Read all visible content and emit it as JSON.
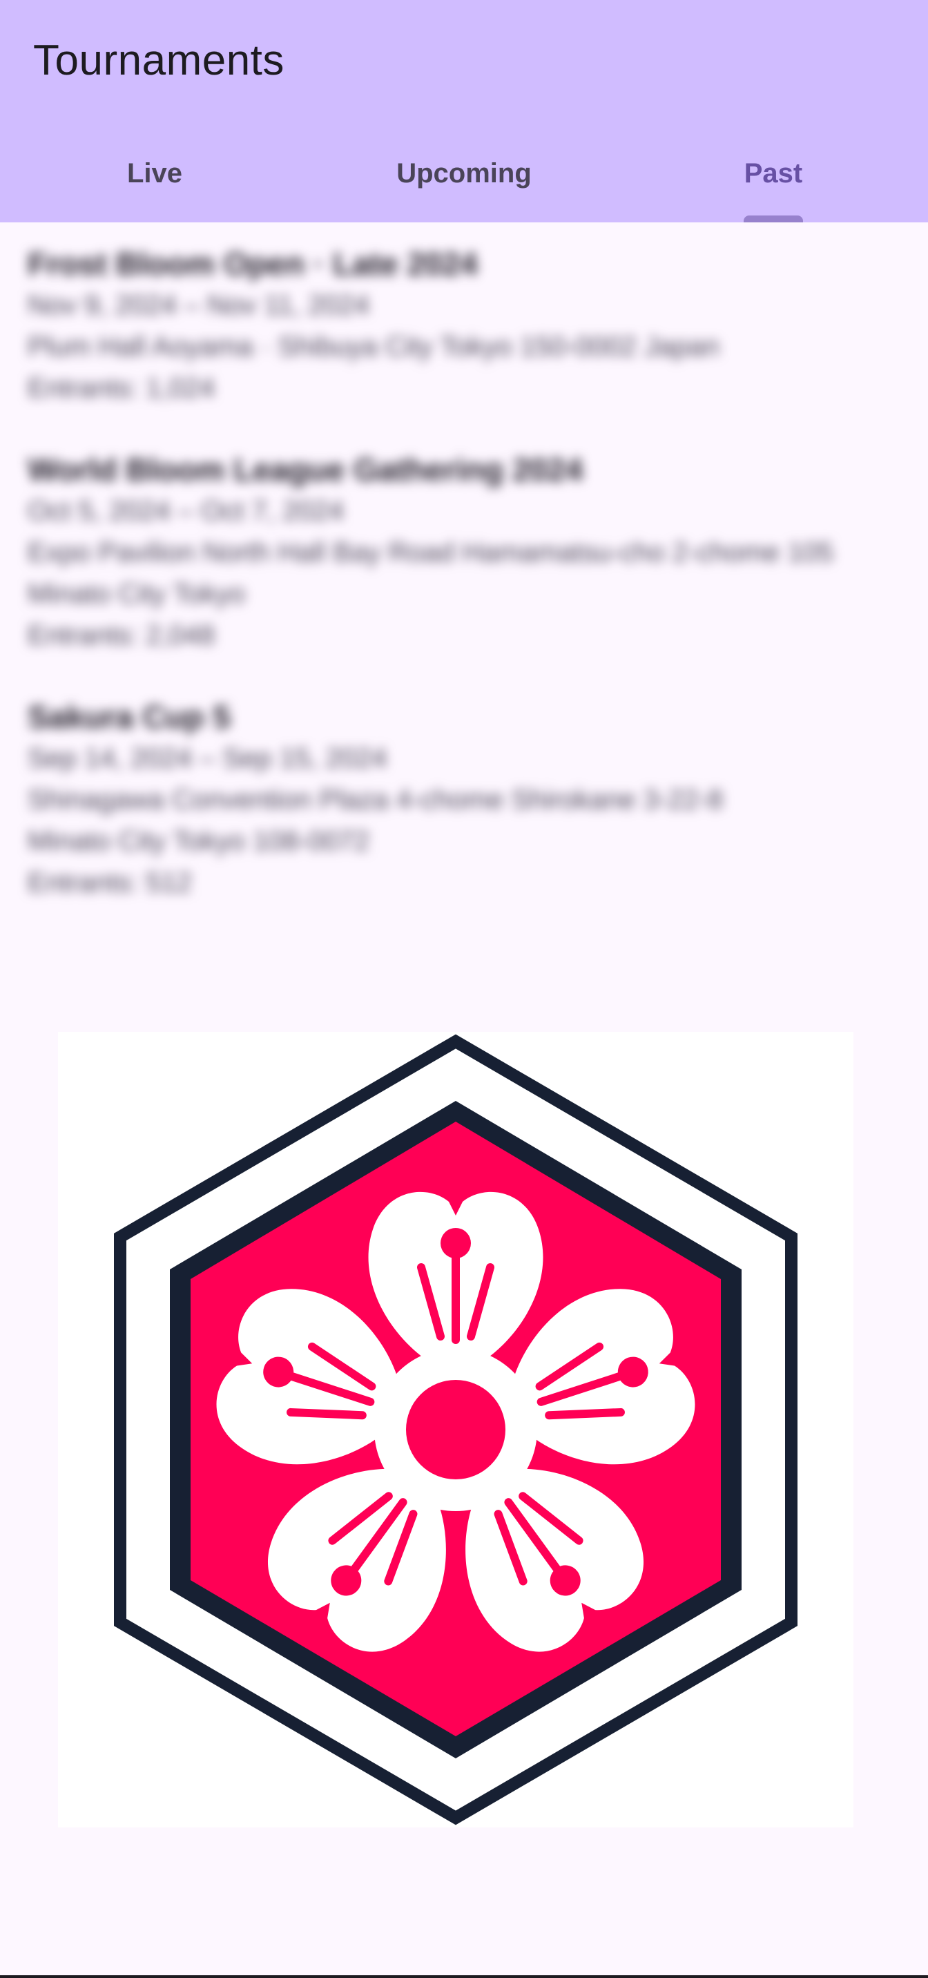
{
  "app_bar": {
    "title": "Tournaments"
  },
  "tabs": [
    {
      "label": "Live",
      "active": false
    },
    {
      "label": "Upcoming",
      "active": false
    },
    {
      "label": "Past",
      "active": true
    }
  ],
  "tournaments": [
    {
      "name": "Frost Bloom Open · Late 2024",
      "dates": "Nov 9, 2024 – Nov 11, 2024",
      "description": "Plum Hall Aoyama · Shibuya City Tokyo 150-0002 Japan",
      "entrants": "Entrants: 1,024"
    },
    {
      "name": "World Bloom League Gathering 2024",
      "dates": "Oct 5, 2024 – Oct 7, 2024",
      "description": "Expo Pavilion North Hall Bay Road Hamamatsu-cho 2-chome 105",
      "description_2": "Minato City Tokyo",
      "entrants": "Entrants: 2,048"
    },
    {
      "name": "Sakura Cup 5",
      "dates": "Sep 14, 2024 – Sep 15, 2024",
      "description": "Shinagawa Convention Plaza 4-chome Shirokane 3-22-8",
      "description_2": "Minato City Tokyo 108-0072",
      "entrants": "Entrants: 512"
    }
  ],
  "logo": {
    "icon": "sakura-hexagon-logo",
    "colors": {
      "outline": "#172033",
      "fill": "#ff0055",
      "petal": "#ffffff"
    }
  },
  "colors": {
    "app_bar": "#d0bcff",
    "background": "#fdf7ff",
    "active_tab": "#6750a4",
    "inactive_tab": "#4a4458"
  }
}
